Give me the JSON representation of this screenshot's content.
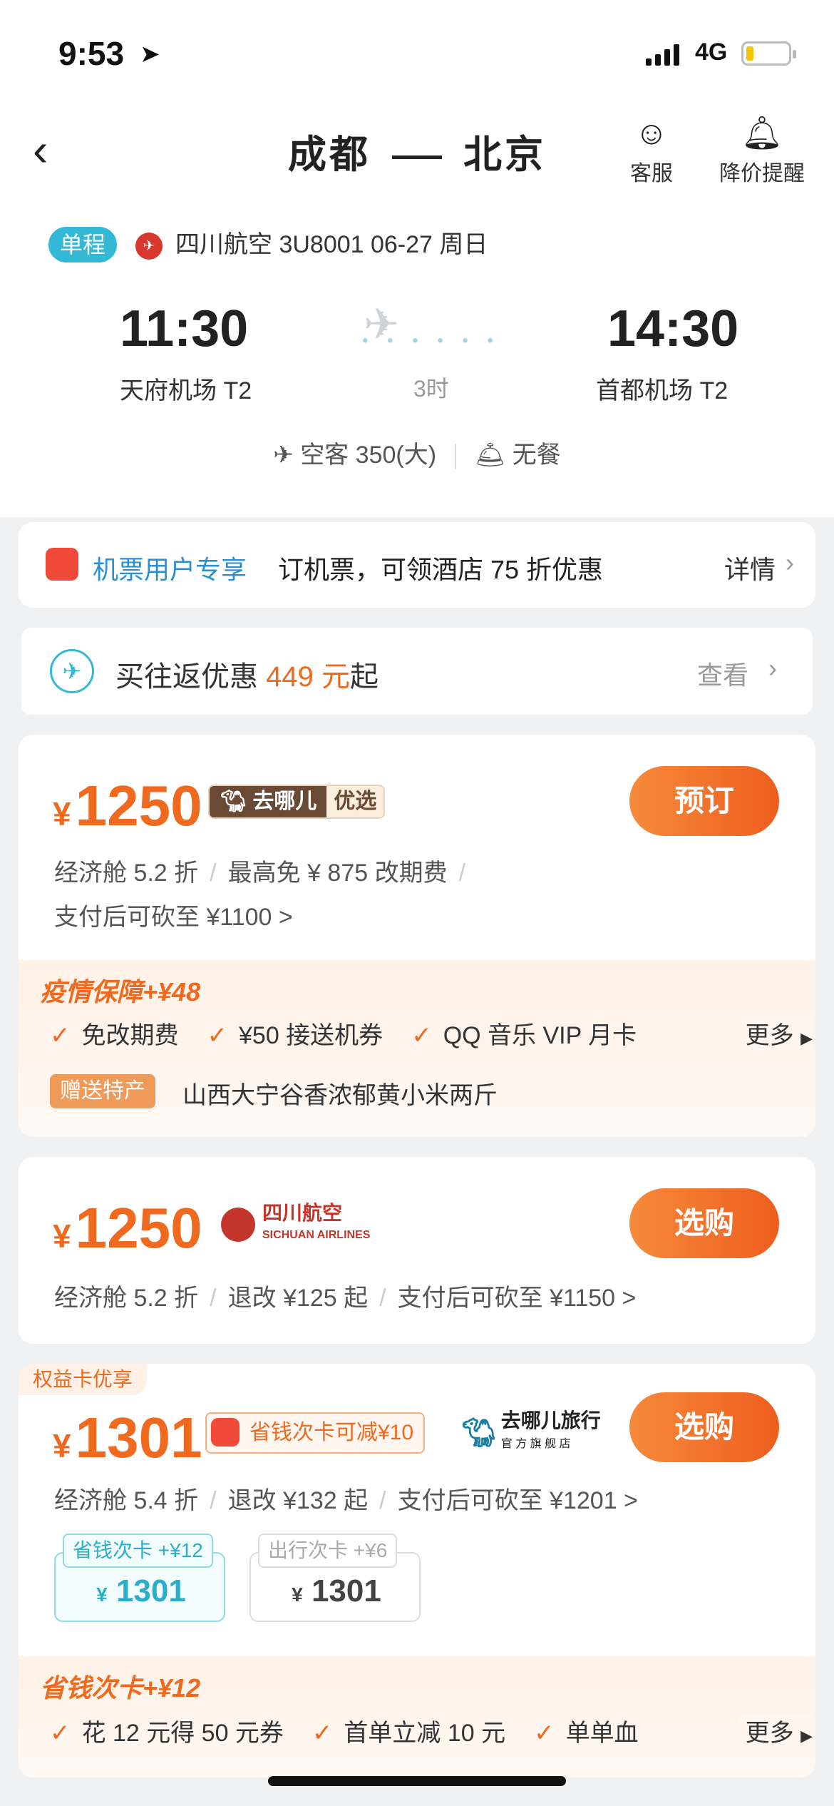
{
  "status": {
    "time": "9:53",
    "network": "4G"
  },
  "nav": {
    "origin": "成都",
    "destination": "北京",
    "service_label": "客服",
    "alert_label": "降价提醒"
  },
  "flight": {
    "trip_type": "单程",
    "airline_info": "四川航空 3U8001  06-27 周日",
    "dep_time": "11:30",
    "dep_airport": "天府机场 T2",
    "arr_time": "14:30",
    "arr_airport": "首都机场 T2",
    "duration": "3时",
    "aircraft": "空客 350(大)",
    "meal": "无餐"
  },
  "promo": {
    "badge": "机票用户专享",
    "text": "订机票，可领酒店 75 折优惠",
    "link": "详情"
  },
  "roundtrip": {
    "prefix": "买往返优惠 ",
    "price": "449 元",
    "suffix": "起",
    "link": "查看"
  },
  "offers": [
    {
      "currency": "¥",
      "price": "1250",
      "tag_a": "去哪儿",
      "tag_b": "优选",
      "button": "预订",
      "line1": [
        "经济舱 5.2 折",
        "最高免 ¥ 875 改期费"
      ],
      "line2": "支付后可砍至 ¥1100 >",
      "perk_title": "疫情保障+¥48",
      "perks": [
        "免改期费",
        "¥50 接送机券",
        "QQ 音乐 VIP 月卡"
      ],
      "more": "更多",
      "gift_label": "赠送特产",
      "gift_text": "山西大宁谷香浓郁黄小米两斤"
    },
    {
      "currency": "¥",
      "price": "1250",
      "brand": "四川航空",
      "brand_en": "SICHUAN AIRLINES",
      "button": "选购",
      "line1": [
        "经济舱 5.2 折",
        "退改 ¥125 起",
        "支付后可砍至 ¥1150 >"
      ]
    },
    {
      "ribbon": "权益卡优享",
      "currency": "¥",
      "price": "1301",
      "card_tag": "省钱次卡可减¥10",
      "brand": "去哪儿旅行",
      "brand_sub": "官 方 旗 舰 店",
      "button": "选购",
      "line1": [
        "经济舱 5.4 折",
        "退改 ¥132 起",
        "支付后可砍至 ¥1201 >"
      ],
      "options": [
        {
          "label": "省钱次卡 +¥12",
          "currency": "¥",
          "value": "1301"
        },
        {
          "label": "出行次卡 +¥6",
          "currency": "¥",
          "value": "1301"
        }
      ],
      "perk_title": "省钱次卡+¥12",
      "perks": [
        "花 12 元得 50 元券",
        "首单立减 10 元",
        "单单血"
      ],
      "more": "更多"
    }
  ],
  "colors": {
    "accent": "#ef6a1e",
    "teal": "#33b8d6",
    "bg": "#f0f1f3"
  }
}
